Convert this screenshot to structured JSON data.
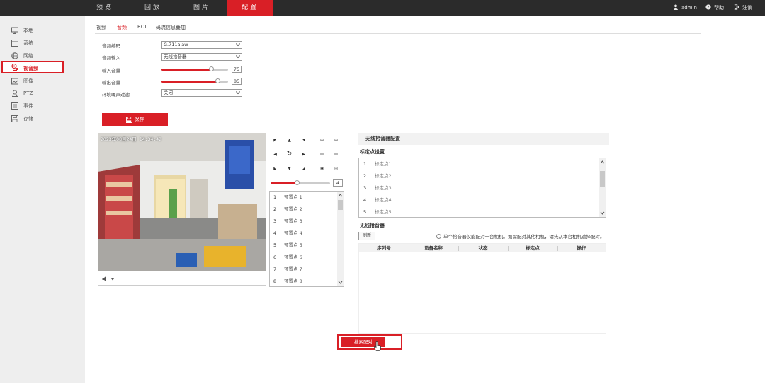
{
  "top_nav": {
    "tabs": [
      {
        "label": "预览",
        "active": false
      },
      {
        "label": "回放",
        "active": false
      },
      {
        "label": "图片",
        "active": false
      },
      {
        "label": "配置",
        "active": true
      }
    ],
    "user": "admin",
    "help": "帮助",
    "logout": "注销"
  },
  "sidebar": {
    "items": [
      {
        "label": "本地",
        "icon": "monitor-icon"
      },
      {
        "label": "系统",
        "icon": "system-icon"
      },
      {
        "label": "网络",
        "icon": "globe-icon"
      },
      {
        "label": "视音频",
        "icon": "audio-video-icon",
        "active": true
      },
      {
        "label": "图像",
        "icon": "image-icon"
      },
      {
        "label": "PTZ",
        "icon": "ptz-icon"
      },
      {
        "label": "事件",
        "icon": "event-icon"
      },
      {
        "label": "存储",
        "icon": "storage-icon"
      }
    ]
  },
  "subtabs": [
    {
      "label": "视频",
      "active": false
    },
    {
      "label": "音频",
      "active": true
    },
    {
      "label": "ROI",
      "active": false
    },
    {
      "label": "码流信息叠加",
      "active": false
    }
  ],
  "form": {
    "audio_encoding": {
      "label": "音频编码",
      "value": "G.711alaw"
    },
    "audio_input": {
      "label": "音频输入",
      "value": "无线拾音器"
    },
    "input_volume": {
      "label": "输入音量",
      "value": "75",
      "level": 0.75
    },
    "output_volume": {
      "label": "输出音量",
      "value": "85",
      "level": 0.85
    },
    "noise_filter": {
      "label": "环境噪声过滤",
      "value": "关闭"
    }
  },
  "save_button": "保存",
  "video": {
    "osd": "2023年08月24日 14:34:42"
  },
  "ptz": {
    "speed": "4",
    "speed_level": 0.45,
    "presets": [
      {
        "num": "1",
        "label": "预置点 1"
      },
      {
        "num": "2",
        "label": "预置点 2"
      },
      {
        "num": "3",
        "label": "预置点 3"
      },
      {
        "num": "4",
        "label": "预置点 4"
      },
      {
        "num": "5",
        "label": "预置点 5"
      },
      {
        "num": "6",
        "label": "预置点 6"
      },
      {
        "num": "7",
        "label": "预置点 7"
      },
      {
        "num": "8",
        "label": "预置点 8"
      }
    ]
  },
  "wireless": {
    "header": "无线拾音器配置",
    "calib_title": "标定点设置",
    "calib_points": [
      {
        "num": "1",
        "label": "标定点1"
      },
      {
        "num": "2",
        "label": "标定点2"
      },
      {
        "num": "3",
        "label": "标定点3"
      },
      {
        "num": "4",
        "label": "标定点4"
      },
      {
        "num": "5",
        "label": "标定点5"
      }
    ],
    "mic_title": "无线拾音器",
    "refresh": "刷新",
    "note": "单个拾音器仅能配对一台相机。如需配对其他相机，请先从本台相机遭择配对。",
    "columns": [
      "序列号",
      "设备名称",
      "状态",
      "标定点",
      "操作"
    ],
    "pair_button": "搜索配对"
  },
  "colors": {
    "accent": "#d91f26",
    "topbar": "#2b2b2b",
    "sidebar": "#eeeeee"
  }
}
